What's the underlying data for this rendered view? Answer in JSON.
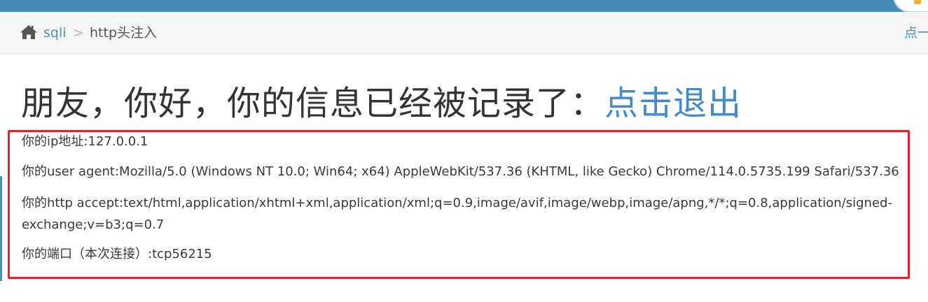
{
  "breadcrumb": {
    "home_link": "sqli",
    "separator": ">",
    "current": "http头注入",
    "right_link": "点一"
  },
  "headline": {
    "text": "朋友，你好，你的信息已经被记录了：",
    "logout_link": "点击退出"
  },
  "info": {
    "ip": "你的ip地址:127.0.0.1",
    "user_agent": "你的user agent:Mozilla/5.0 (Windows NT 10.0; Win64; x64) AppleWebKit/537.36 (KHTML, like Gecko) Chrome/114.0.5735.199 Safari/537.36",
    "accept_line1": "你的http accept:text/html,application/xhtml+xml,application/xml;q=0.9,image/avif,image/webp,image/apng,*/*;q=0.8,application/signed-",
    "accept_line2": "exchange;v=b3;q=0.7",
    "port": "你的端口（本次连接）:tcp56215"
  },
  "colors": {
    "topbar": "#438eb9",
    "link": "#428bca",
    "highlight_border": "#e6212a"
  },
  "icons": {
    "home": "home-icon",
    "avatar": "avatar-icon"
  }
}
